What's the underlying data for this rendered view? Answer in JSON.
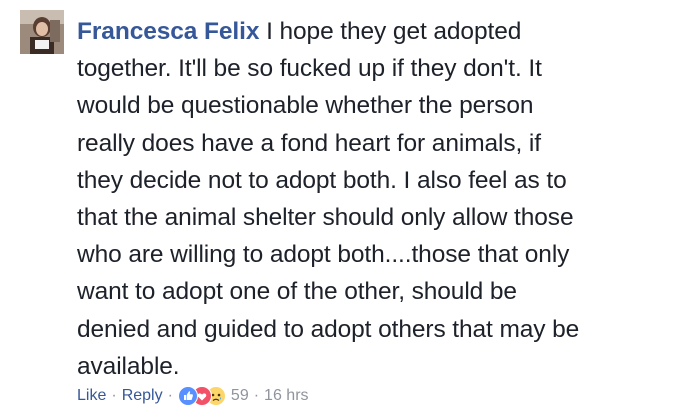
{
  "comment": {
    "author": "Francesca Felix",
    "text": "I hope they get adopted together. It'll be so fucked up if they don't. It would be questionable whether the person really does have a fond heart for animals, if they decide not to adopt both. I also feel as to that the animal shelter should only allow those who are willing to adopt both....those that only want to adopt one of the other, should be denied and guided to adopt others that may be available.",
    "lines": [
      "together. It'll be so fucked up if they don't. It",
      "would be questionable whether the person",
      "really does have a fond heart for animals, if",
      "they decide not to adopt both. I also feel as to",
      "that the animal shelter should only allow those",
      "who are willing to adopt both....those that only",
      "want to adopt one of the other, should be",
      "denied and guided to adopt others that may be",
      "available."
    ],
    "first_line": "I hope they get adopted",
    "actions": {
      "like_label": "Like",
      "reply_label": "Reply",
      "reaction_count": "59",
      "timestamp": "16 hrs",
      "separator": "·"
    },
    "reaction_icons": [
      "like-icon",
      "love-icon",
      "sad-icon"
    ]
  },
  "colors": {
    "author": "#365899",
    "text": "#1d2129",
    "meta": "#90949c",
    "like_blue": "#5890ff",
    "love_red": "#f25268",
    "sad_yellow": "#fcd669"
  }
}
